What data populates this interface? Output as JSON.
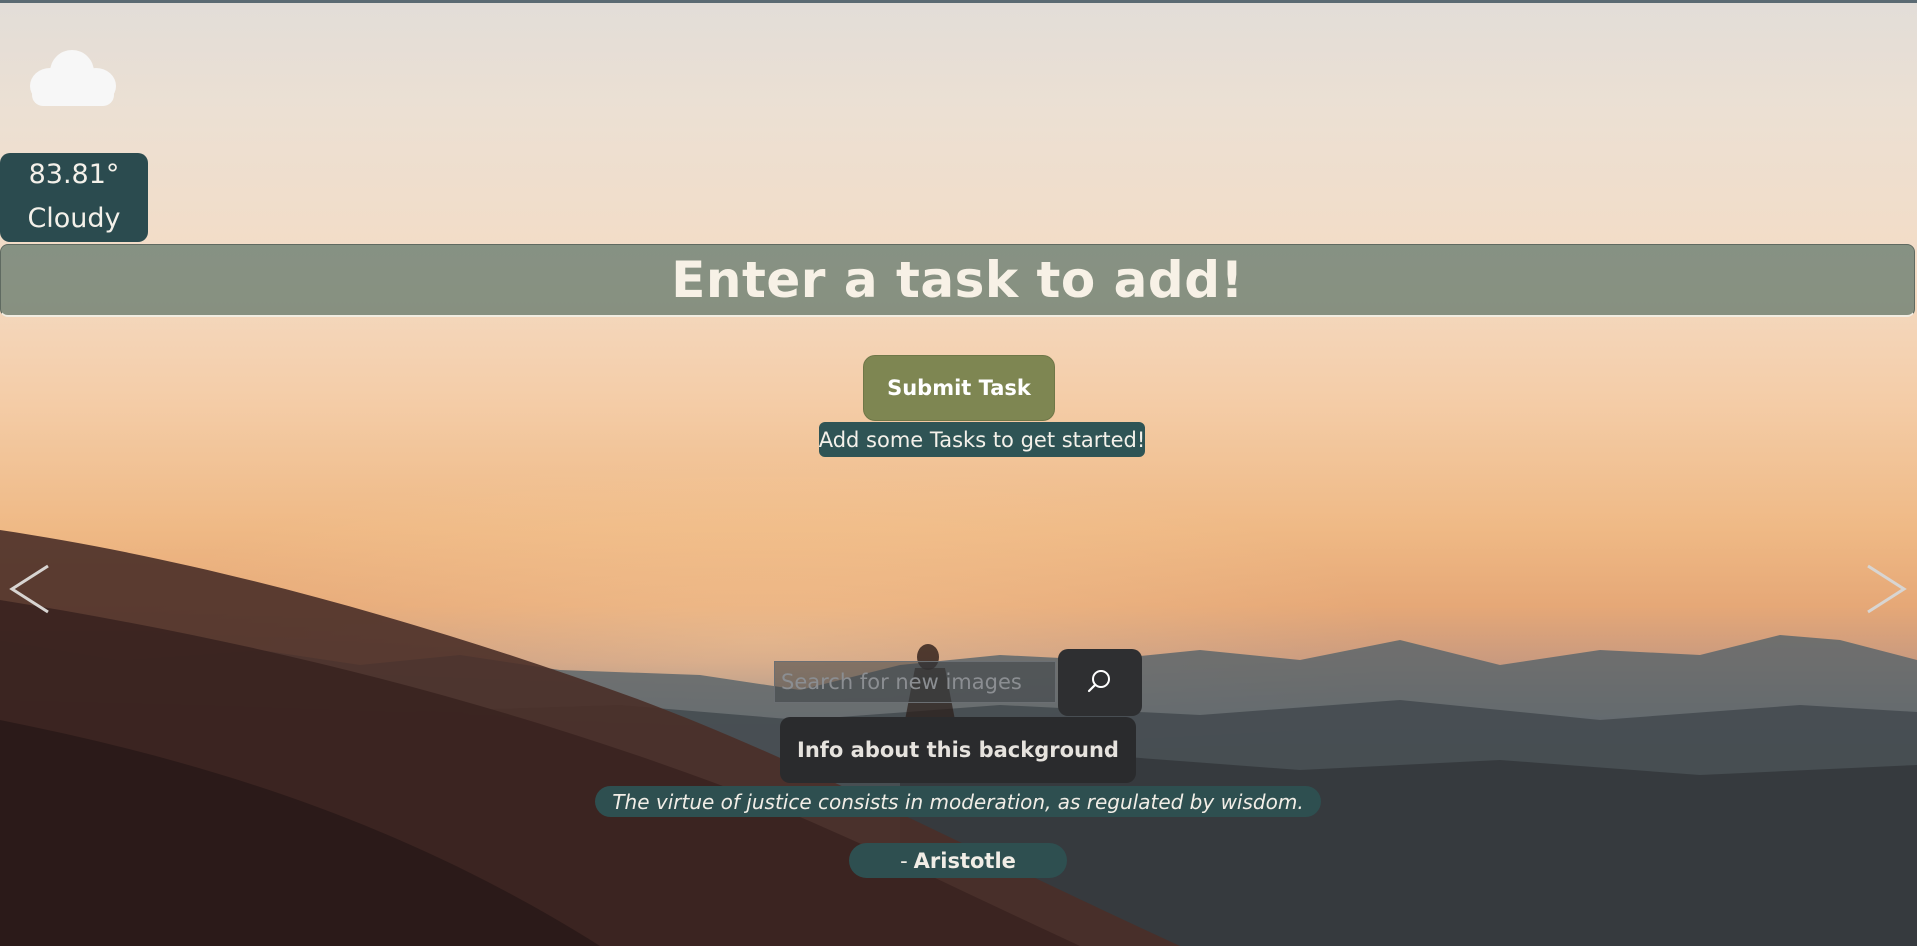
{
  "weather": {
    "icon": "cloud-icon",
    "temperature": "83.81°",
    "condition": "Cloudy"
  },
  "task": {
    "placeholder": "Enter a task to add!",
    "submit_label": "Submit Task",
    "empty_message": "Add some Tasks to get started!"
  },
  "navigation": {
    "prev_icon": "chevron-left-icon",
    "next_icon": "chevron-right-icon"
  },
  "search": {
    "placeholder": "Search for new images",
    "icon": "search-icon"
  },
  "background_info": {
    "label": "Info about this background"
  },
  "quote": {
    "text": "The virtue of justice consists in moderation, as regulated by wisdom.",
    "author_prefix": "-",
    "author": "Aristotle"
  },
  "colors": {
    "panel_teal": "#2b4b4f",
    "submit_olive": "#7e8652",
    "dark_button": "#2a2b2d"
  }
}
